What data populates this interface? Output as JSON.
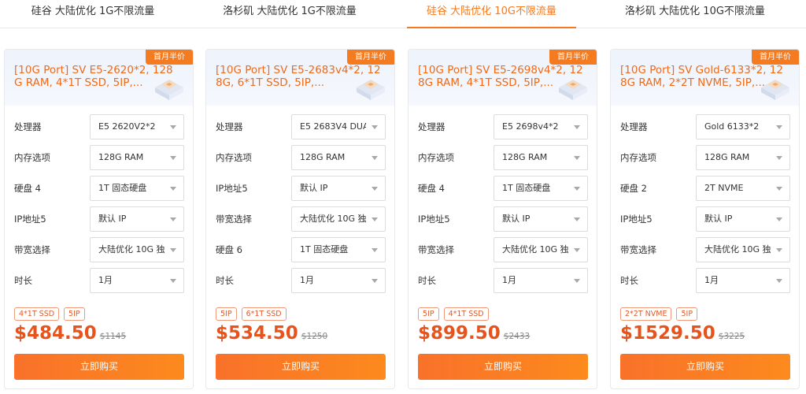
{
  "tabs": [
    {
      "label": "硅谷 大陆优化 1G不限流量",
      "active": false
    },
    {
      "label": "洛杉矶 大陆优化 1G不限流量",
      "active": false
    },
    {
      "label": "硅谷 大陆优化 10G不限流量",
      "active": true
    },
    {
      "label": "洛杉矶 大陆优化 10G不限流量",
      "active": false
    }
  ],
  "colors": {
    "accent": "#f57a1f",
    "price": "#e8531c",
    "tag_border": "#f19a7a"
  },
  "cards": [
    {
      "title": "[10G Port] SV E5-2620*2, 128G RAM, 4*1T SSD, 5IP,...",
      "ribbon": "首月半价",
      "rows": [
        {
          "label": "处理器",
          "value": "E5 2620V2*2"
        },
        {
          "label": "内存选项",
          "value": "128G RAM"
        },
        {
          "label": "硬盘 4",
          "value": "1T 固态硬盘"
        },
        {
          "label": "IP地址5",
          "value": "默认 IP"
        },
        {
          "label": "带宽选择",
          "value": "大陆优化 10G 独"
        },
        {
          "label": "时长",
          "value": "1月"
        }
      ],
      "tags": [
        "4*1T SSD",
        "5IP"
      ],
      "price": "$484.50",
      "original_price": "$1145",
      "buy_label": "立即购买"
    },
    {
      "title": "[10G Port] SV E5-2683v4*2, 128G, 6*1T SSD, 5IP,...",
      "ribbon": "首月半价",
      "rows": [
        {
          "label": "处理器",
          "value": "E5 2683V4 DUA"
        },
        {
          "label": "内存选项",
          "value": "128G RAM"
        },
        {
          "label": "IP地址5",
          "value": "默认 IP"
        },
        {
          "label": "带宽选择",
          "value": "大陆优化 10G 独"
        },
        {
          "label": "硬盘 6",
          "value": "1T 固态硬盘"
        },
        {
          "label": "时长",
          "value": "1月"
        }
      ],
      "tags": [
        "5IP",
        "6*1T SSD"
      ],
      "price": "$534.50",
      "original_price": "$1250",
      "buy_label": "立即购买"
    },
    {
      "title": "[10G Port] SV E5-2698v4*2, 128G RAM, 4*1T SSD, 5IP,...",
      "ribbon": "首月半价",
      "rows": [
        {
          "label": "处理器",
          "value": "E5 2698v4*2"
        },
        {
          "label": "内存选项",
          "value": "128G RAM"
        },
        {
          "label": "硬盘 4",
          "value": "1T 固态硬盘"
        },
        {
          "label": "IP地址5",
          "value": "默认 IP"
        },
        {
          "label": "带宽选择",
          "value": "大陆优化 10G 独"
        },
        {
          "label": "时长",
          "value": "1月"
        }
      ],
      "tags": [
        "5IP",
        "4*1T SSD"
      ],
      "price": "$899.50",
      "original_price": "$2433",
      "buy_label": "立即购买"
    },
    {
      "title": "[10G Port] SV Gold-6133*2, 128G RAM, 2*2T NVME, 5IP,...",
      "ribbon": "首月半价",
      "rows": [
        {
          "label": "处理器",
          "value": "Gold 6133*2"
        },
        {
          "label": "内存选项",
          "value": "128G RAM"
        },
        {
          "label": "硬盘 2",
          "value": "2T NVME"
        },
        {
          "label": "IP地址5",
          "value": "默认 IP"
        },
        {
          "label": "带宽选择",
          "value": "大陆优化 10G 独"
        },
        {
          "label": "时长",
          "value": "1月"
        }
      ],
      "tags": [
        "2*2T NVME",
        "5IP"
      ],
      "price": "$1529.50",
      "original_price": "$3225",
      "buy_label": "立即购买"
    }
  ]
}
